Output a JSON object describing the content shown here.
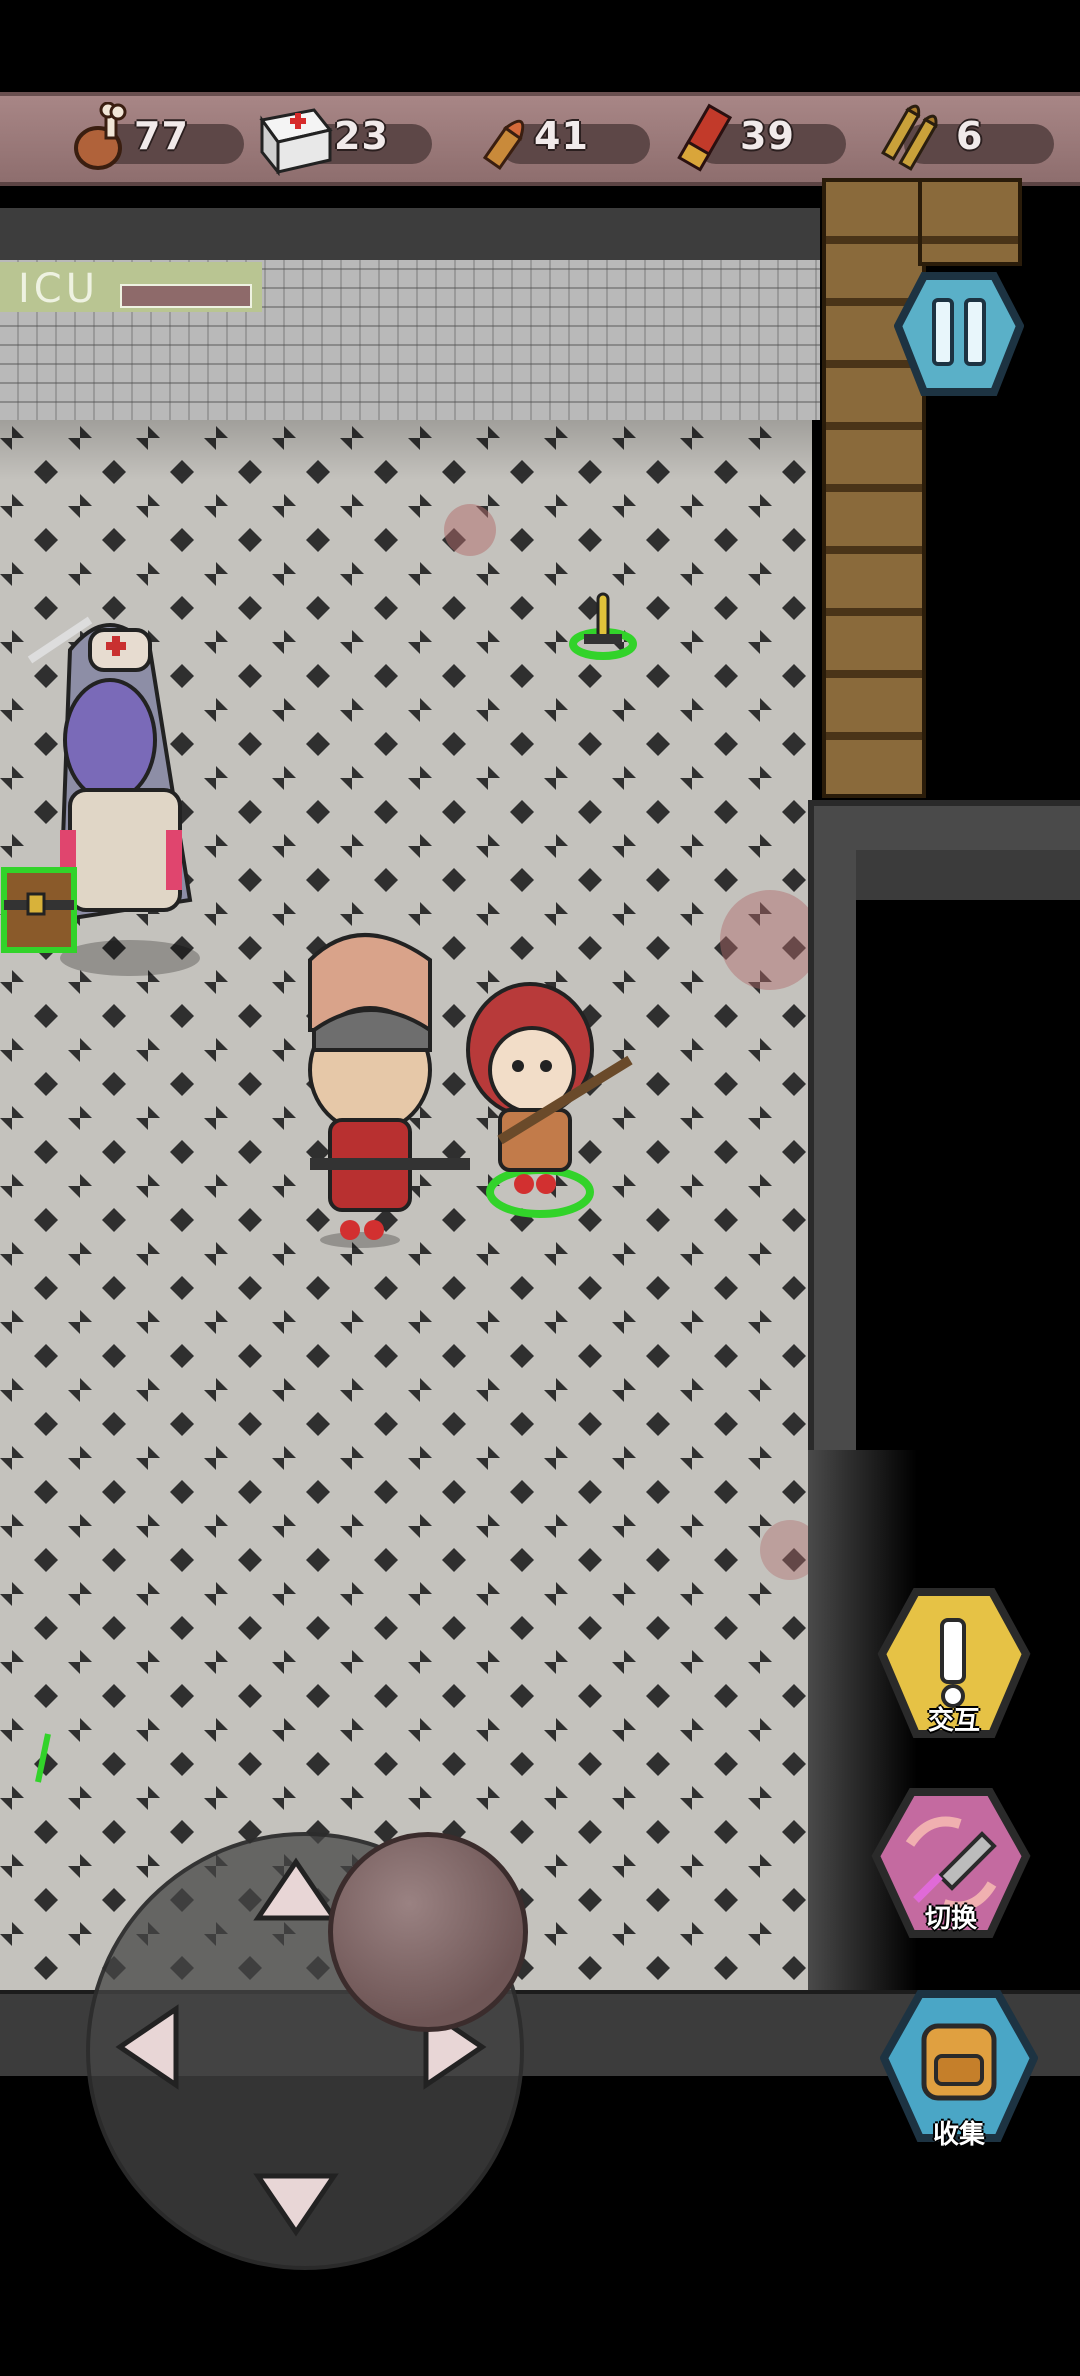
{
  "resources": [
    {
      "icon": "meat-drumstick-icon",
      "value": "77"
    },
    {
      "icon": "first-aid-kit-icon",
      "value": "23"
    },
    {
      "icon": "pistol-bullet-icon",
      "value": "41"
    },
    {
      "icon": "shotgun-shell-icon",
      "value": "39"
    },
    {
      "icon": "rifle-ammo-icon",
      "value": "6"
    }
  ],
  "map": {
    "room_sign": "ICU"
  },
  "controls": {
    "pause": "pause-icon",
    "interact_label": "交互",
    "switch_label": "切换",
    "collect_label": "收集"
  },
  "colors": {
    "resource_bar": "#9b7b7b",
    "interact_button": "#e6c245",
    "switch_button": "#c46aa0",
    "collect_button": "#4aa6c6",
    "pause_button": "#5ab0c8",
    "floor": "#c2c0bb"
  }
}
